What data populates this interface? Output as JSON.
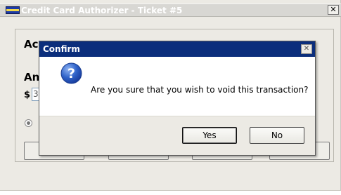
{
  "main_window": {
    "title": "Credit Card Authorizer - Ticket #5",
    "close_glyph": "✕",
    "partial_label_1": "Ac",
    "partial_label_2": "An",
    "currency_symbol": "$",
    "amount_value": "3"
  },
  "dialog": {
    "title": "Confirm",
    "close_glyph": "✕",
    "icon": "question-icon",
    "message": "Are you sure that you wish to void this transaction?",
    "yes_label": "Yes",
    "no_label": "No"
  },
  "colors": {
    "dialog_titlebar": "#0b2e7c",
    "window_background": "#eceae4",
    "question_icon": "#2f63c9"
  }
}
